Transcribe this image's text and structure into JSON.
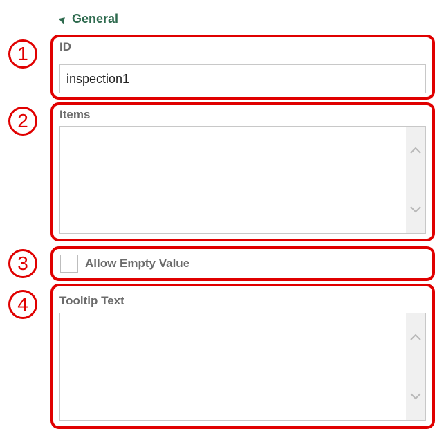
{
  "section": {
    "title": "General",
    "expander_icon": "triangle-expanded-icon"
  },
  "markers": [
    "1",
    "2",
    "3",
    "4"
  ],
  "fields": {
    "id": {
      "label": "ID",
      "value": "inspection1"
    },
    "items": {
      "label": "Items",
      "value": ""
    },
    "allow_empty": {
      "label": "Allow Empty Value",
      "checked": false
    },
    "tooltip": {
      "label": "Tooltip Text",
      "value": ""
    }
  },
  "colors": {
    "highlight": "#e00000",
    "section_title": "#2f6b4f",
    "label": "#6b6b6b"
  }
}
